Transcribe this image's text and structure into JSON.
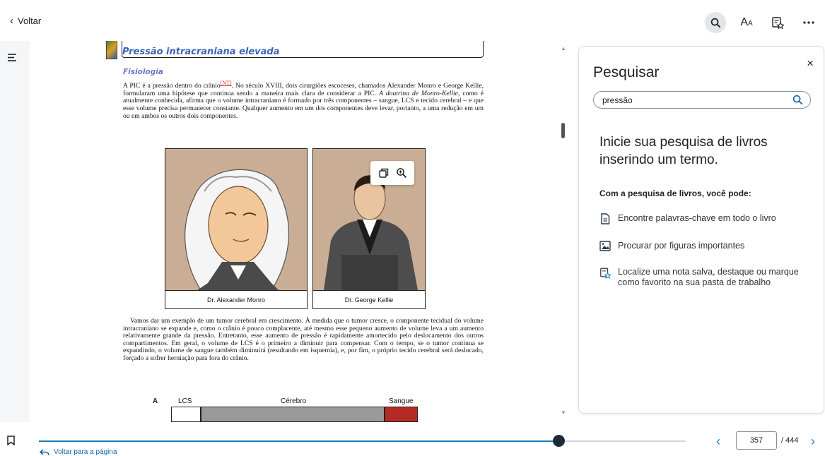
{
  "topbar": {
    "back_label": "Voltar",
    "tools": [
      "search-icon",
      "text-size-icon",
      "notebook-icon",
      "more-icon"
    ],
    "text_size_label": "A",
    "text_size_small": "A"
  },
  "book": {
    "chapter_title": "Pressão intracraniana elevada",
    "section_title": "Fisiologia",
    "para1_a": "A PIC é a pressão dentro do crânio",
    "note_ref": "[NT]",
    "para1_b": ". No século XVIII, dois cirurgiões escoceses, chamados Alexander Monro e George Kellie, formularam uma hipótese que continua sendo a maneira mais clara de considerar a PIC. ",
    "para1_italic": "A doutrina de Monro-Kellie",
    "para1_c": ", como é atualmente conhecida, afirma que o volume intracraniano é formado por três componentes – sangue, LCS e tecido cerebral – e que esse volume precisa permanecer constante. Qualquer aumento em um dos componentes deve levar, portanto, a uma redução em um ou em ambos os outros dois componentes.",
    "fig1_caption": "Dr. Alexander Monro",
    "fig2_caption": "Dr. George Kellie",
    "para2": "Vamos dar um exemplo de um tumor cerebral em crescimento. À medida que o tumor cresce, o componente tecidual do volume intracraniano se expande e, como o crânio é pouco complacente, até mesmo esse pequeno aumento de volume leva a um aumento relativamente grande da pressão. Entretanto, esse aumento de pressão é rapidamente amortecido pelo deslocamento dos outros compartimentos. Em geral, o volume de LCS é o primeiro a diminuir para compensar. Com o tempo, se o tumor continua se expandindo, o volume de sangue também diminuirá (resultando em isquemia), e, por fim, o próprio tecido cerebral será deslocado, forçado a sofrer herniação para fora do crânio.",
    "diagram": {
      "label": "A",
      "segments": [
        {
          "label": "LCS",
          "color": "#ffffff"
        },
        {
          "label": "Cérebro",
          "color": "#9a9a9a"
        },
        {
          "label": "Sangue",
          "color": "#b52a22"
        }
      ]
    }
  },
  "search_panel": {
    "title": "Pesquisar",
    "close_label": "×",
    "input_value": "pressão",
    "headline": "Inicie sua pesquisa de livros inserindo um termo.",
    "subheading": "Com a pesquisa de livros, você pode:",
    "items": [
      {
        "icon": "document-icon",
        "text": "Encontre palavras-chave em todo o livro"
      },
      {
        "icon": "image-icon",
        "text": "Procurar por figuras importantes"
      },
      {
        "icon": "notebook-star-icon",
        "text": "Localize uma nota salva, destaque ou marque como favorito na sua pasta de trabalho"
      }
    ]
  },
  "bottombar": {
    "return_label": "Voltar para a página",
    "current_page": "357",
    "total_pages": "/ 444",
    "progress": 0.804
  },
  "colors": {
    "accent": "#1a7fbf",
    "chapter_title": "#3c64b4",
    "section_title": "#6a78c8"
  }
}
